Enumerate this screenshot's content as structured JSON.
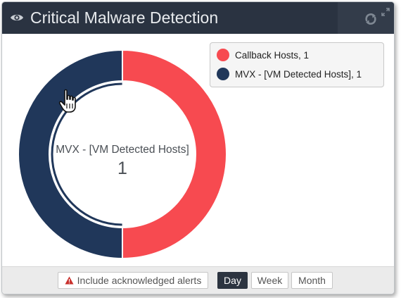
{
  "widget": {
    "title": "Critical Malware Detection",
    "icons": {
      "title": "eye-icon",
      "refresh": "refresh-icon",
      "expand": "expand-icon",
      "cursor": "hand-pointer-cursor-icon",
      "warning": "warning-triangle-icon"
    }
  },
  "colors": {
    "header": "#2a3341",
    "callback": "#f74a50",
    "mvx": "#20375a",
    "active_button": "#2c3440"
  },
  "chart_data": {
    "type": "pie",
    "donut": true,
    "categories": [
      "Callback Hosts",
      "MVX - [VM Detected Hosts]"
    ],
    "values": [
      1,
      1
    ],
    "colors": [
      "#f74a50",
      "#20375a"
    ],
    "legend_position": "top-right",
    "center": {
      "label": "MVX - [VM Detected Hosts]",
      "value": "1"
    },
    "highlighted": "MVX - [VM Detected Hosts]"
  },
  "legend": {
    "items": [
      {
        "label": "Callback Hosts, 1",
        "color": "#f74a50"
      },
      {
        "label": "MVX - [VM Detected Hosts], 1",
        "color": "#20375a"
      }
    ]
  },
  "footer": {
    "ack_label": "Include acknowledged alerts",
    "ranges": [
      "Day",
      "Week",
      "Month"
    ],
    "selected_range": "Day"
  }
}
